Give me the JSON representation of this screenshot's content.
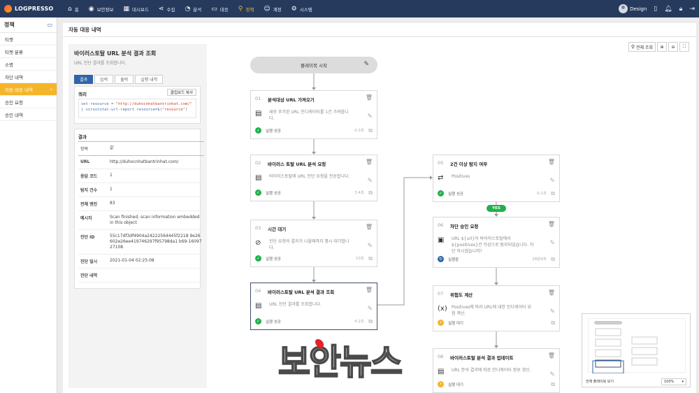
{
  "app": {
    "name": "LOGPRESSO"
  },
  "nav": [
    {
      "label": "홈",
      "icon": "home-icon",
      "glyph": "⌂"
    },
    {
      "label": "보안정보",
      "icon": "shield-icon",
      "glyph": "◉"
    },
    {
      "label": "대시보드",
      "icon": "dashboard-icon",
      "glyph": "▦"
    },
    {
      "label": "수집",
      "icon": "share-icon",
      "glyph": "⋖"
    },
    {
      "label": "분석",
      "icon": "pie-chart-icon",
      "glyph": "◔"
    },
    {
      "label": "대응",
      "icon": "monitor-icon",
      "glyph": "▭"
    },
    {
      "label": "정책",
      "icon": "search-icon",
      "glyph": "⚲",
      "active": true
    },
    {
      "label": "계정",
      "icon": "user-icon",
      "glyph": "☺"
    },
    {
      "label": "시스템",
      "icon": "gear-icon",
      "glyph": "⚙"
    }
  ],
  "user": {
    "name": "Design"
  },
  "sidebar": {
    "title": "정책",
    "items": [
      {
        "label": "티켓"
      },
      {
        "label": "티켓 분류"
      },
      {
        "label": "소명"
      },
      {
        "label": "차단 내역"
      },
      {
        "label": "자동 대응 내역",
        "active": true
      },
      {
        "label": "승인 요청"
      },
      {
        "label": "승인 내역"
      }
    ]
  },
  "page": {
    "title": "자동 대응 내역"
  },
  "detail": {
    "title": "바이러스토탈 URL 분석 결과 조회",
    "subtitle": "URL 진단 결과를 조회합니다.",
    "tabs": [
      {
        "label": "결과",
        "active": true
      },
      {
        "label": "입력"
      },
      {
        "label": "출력"
      },
      {
        "label": "실행 내역"
      }
    ],
    "query": {
      "title": "쿼리",
      "copy_label": "클립보드 복사",
      "line1_prefix": "set resource = ",
      "line1_string": "\"http://duhocnhatbantrinhat.com/\"",
      "line2_prefix": "| virustotal-url-report resource=$(",
      "line2_string": "\"resource\"",
      "line2_suffix": ")"
    },
    "result": {
      "title": "결과",
      "header": {
        "k": "항목",
        "v": "값"
      },
      "rows": [
        {
          "k": "URL",
          "v": "http://duhocnhatbantrinhat.com/"
        },
        {
          "k": "응답 코드",
          "v": "1"
        },
        {
          "k": "탐지 건수",
          "v": "1"
        },
        {
          "k": "전체 엔진",
          "v": "83"
        },
        {
          "k": "메시지",
          "v": "Scan finished, scan information embedded in this object"
        },
        {
          "k": "진단 ID",
          "v": "55c17df3df4904a24222564445f2218 9e26602e26ee419746297f95798da1 b69-1609727108"
        },
        {
          "k": "진단 일시",
          "v": "2021-01-04 02:25:08"
        },
        {
          "k": "진단 내역",
          "v": ""
        }
      ]
    }
  },
  "toolbar": {
    "fit_label": "전체 조회"
  },
  "flow": {
    "start_label": "플레이북 시작",
    "cards": [
      {
        "num": "01",
        "title": "분석대상 URL 가져오기",
        "desc": "새로 추가된 URL 인디케이터를 1건 가져옵니다.",
        "status": "실행 성공",
        "time": "0.3초",
        "state": "ok",
        "icon": "document-icon",
        "glyph": "▤"
      },
      {
        "num": "02",
        "title": "바이러스 토탈 URL 분석 요청",
        "desc": "바이러스토탈에 URL 진단 요청을 전송합니다.",
        "status": "실행 성공",
        "time": "3.4초",
        "state": "ok",
        "icon": "document-icon",
        "glyph": "▤"
      },
      {
        "num": "03",
        "title": "시간 대기",
        "desc": "진단 요청의 결과가 나올때까지 몇시 대기합니다.",
        "status": "실행 성공",
        "time": "10초",
        "state": "ok",
        "icon": "timer-off-icon",
        "glyph": "⊘"
      },
      {
        "num": "04",
        "title": "바이러스토탈 URL 분석 결과 조회",
        "desc": "URL 진단 결과를 조회합니다.",
        "status": "실행 성공",
        "time": "4.2초",
        "state": "ok",
        "icon": "document-icon",
        "glyph": "▤",
        "selected": true
      },
      {
        "num": "05",
        "title": "2건 이상 탐지 여부",
        "desc": "Positives",
        "status": "실행 성공",
        "time": "0.1초",
        "state": "ok",
        "icon": "branch-icon",
        "glyph": "⇄"
      },
      {
        "num": "06",
        "title": "차단 승인 요청",
        "desc": "URL ${url}이 바이러스토탈에서 ${positives}건 악성으로 탐지되었습니다. 차단 하시겠습니까?",
        "status": "실행중",
        "time": "28분9초",
        "state": "run",
        "icon": "clipboard-icon",
        "glyph": "▣"
      },
      {
        "num": "07",
        "title": "위험도 계산",
        "desc": "Positives에 따라 URL에 대한 인디케이터 위험 계산.",
        "status": "실행 대기",
        "time": "",
        "state": "wait",
        "icon": "formula-icon",
        "glyph": "(x)"
      },
      {
        "num": "08",
        "title": "바이러스토탈 분석 결과 업데이트",
        "desc": "URL 분석 결과에 따른 인디케이터 정보 갱신.",
        "status": "실행 대기",
        "time": "",
        "state": "wait",
        "icon": "document-icon",
        "glyph": "▤"
      }
    ],
    "yes_label": "YES"
  },
  "minimap": {
    "label": "전체 플레이북 보기",
    "zoom": "100%"
  },
  "watermark": "보안뉴스"
}
